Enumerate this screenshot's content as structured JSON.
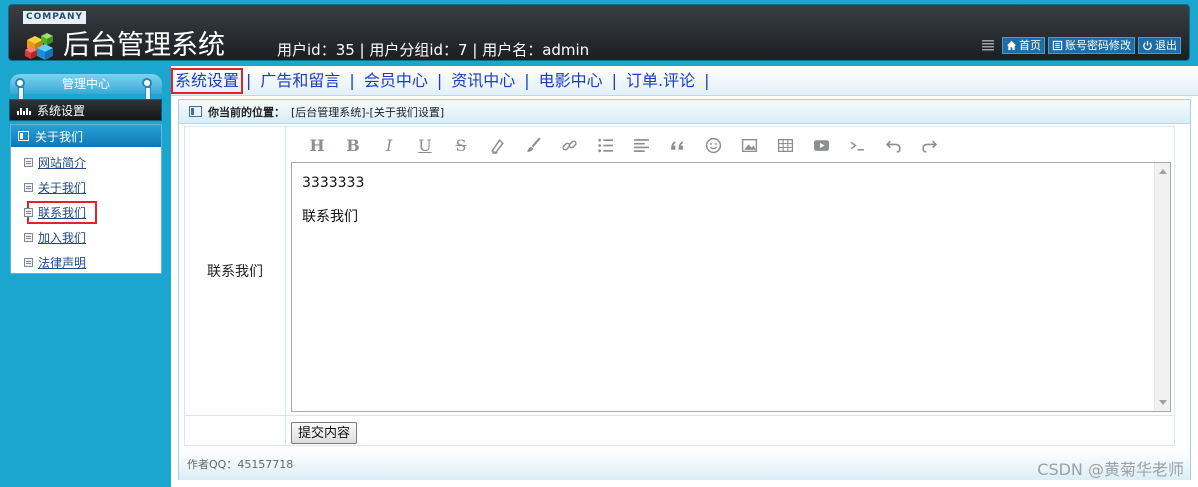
{
  "header": {
    "company_tag": "COMPANY",
    "title": "后台管理系统",
    "user_info": "用户id：35 | 用户分组id：7 | 用户名：admin",
    "buttons": [
      {
        "label": "首页",
        "icon": "home-icon"
      },
      {
        "label": "账号密码修改",
        "icon": "account-icon"
      },
      {
        "label": "退出",
        "icon": "power-icon"
      }
    ]
  },
  "sidebar": {
    "heading": "管理中心",
    "tab_label": "系统设置",
    "section_title": "关于我们",
    "items": [
      "网站简介",
      "关于我们",
      "联系我们",
      "加入我们",
      "法律声明"
    ],
    "selected_item": "联系我们"
  },
  "topnav": {
    "items": [
      "系统设置",
      "广告和留言",
      "会员中心",
      "资讯中心",
      "电影中心",
      "订单.评论"
    ],
    "separator": "|",
    "active": "系统设置"
  },
  "main": {
    "crumb_label": "你当前的位置：",
    "crumb_path": "[后台管理系统]-[关于我们设置]",
    "field_label": "联系我们",
    "editor_lines": [
      "3333333",
      "联系我们"
    ],
    "submit_label": "提交内容",
    "footer_text": "作者QQ：45157718"
  },
  "watermark": "CSDN @黄菊华老师",
  "colors": {
    "header_bg": "#1aa6cf",
    "nav_link": "#1c3cc4",
    "highlight_border": "#e0242a"
  }
}
